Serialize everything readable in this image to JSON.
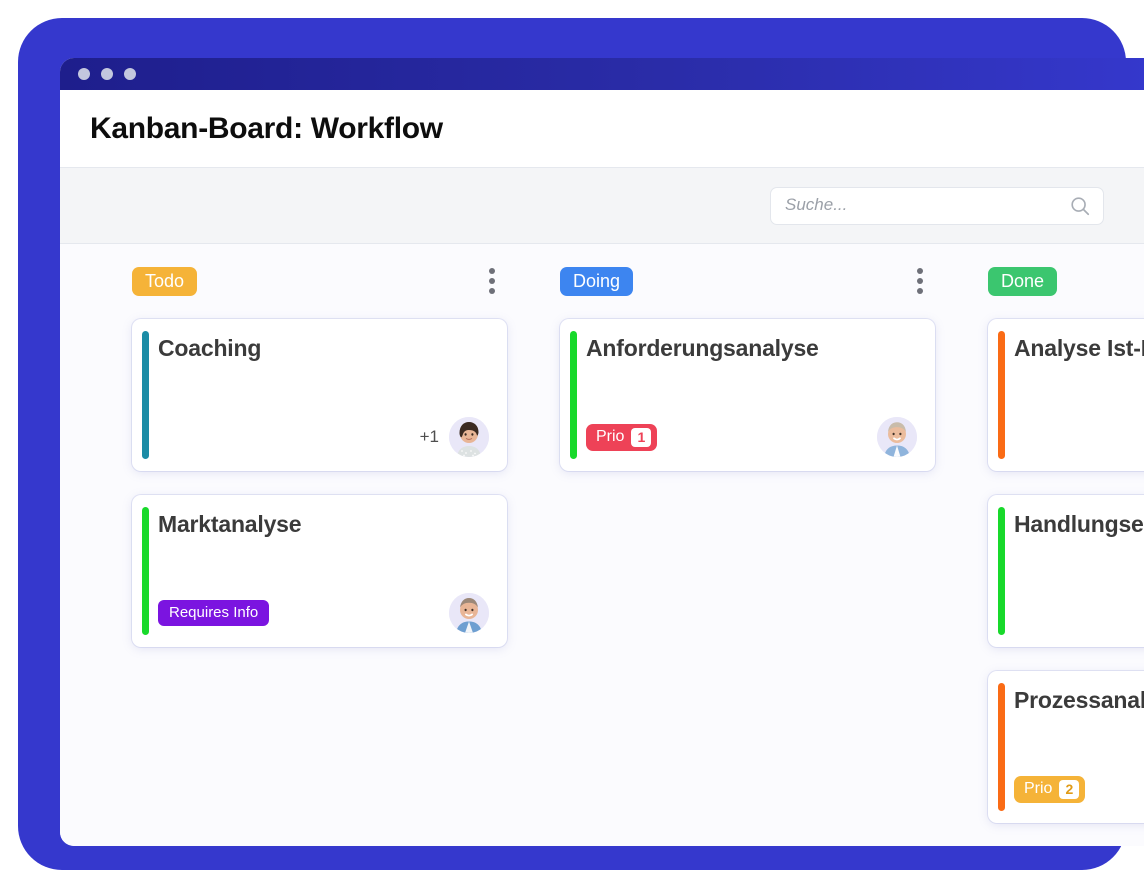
{
  "window": {
    "traffic_lights": [
      "close-dot",
      "minimize-dot",
      "maximize-dot"
    ]
  },
  "header": {
    "title": "Kanban-Board: Workflow"
  },
  "toolbar": {
    "search": {
      "placeholder": "Suche...",
      "value": "",
      "icon": "search-icon"
    }
  },
  "board": {
    "columns": [
      {
        "id": "todo",
        "label": "Todo",
        "badge_color": "#F5B338",
        "menu_icon": "more-vertical-icon",
        "cards": [
          {
            "title": "Coaching",
            "accent_color": "#1B8CA6",
            "tags": [],
            "overflow_count": "+1",
            "avatar": "avatar-female-dark-hair"
          },
          {
            "title": "Marktanalyse",
            "accent_color": "#18D92B",
            "tags": [
              {
                "type": "plain",
                "label": "Requires Info",
                "color": "#7B14E0"
              }
            ],
            "overflow_count": "",
            "avatar": "avatar-male-blue-shirt"
          }
        ]
      },
      {
        "id": "doing",
        "label": "Doing",
        "badge_color": "#3D85F0",
        "menu_icon": "more-vertical-icon",
        "cards": [
          {
            "title": "Anforderungsanalyse",
            "accent_color": "#18D92B",
            "tags": [
              {
                "type": "count",
                "label": "Prio",
                "count": "1",
                "color": "#EE4257",
                "count_color": "#EE4257"
              }
            ],
            "overflow_count": "",
            "avatar": "avatar-male-light-hair"
          }
        ]
      },
      {
        "id": "done",
        "label": "Done",
        "badge_color": "#3BC66F",
        "menu_icon": "more-vertical-icon",
        "cards": [
          {
            "title": "Analyse Ist-Prozesse",
            "accent_color": "#FA6B15",
            "tags": [],
            "overflow_count": "",
            "avatar": ""
          },
          {
            "title": "Handlungsempfehlungen",
            "accent_color": "#18D92B",
            "tags": [],
            "overflow_count": "",
            "avatar": ""
          },
          {
            "title": "Prozessanalyse",
            "accent_color": "#FA6B15",
            "tags": [
              {
                "type": "count",
                "label": "Prio",
                "count": "2",
                "color": "#F5B338",
                "count_color": "#E09B17"
              }
            ],
            "overflow_count": "",
            "avatar": ""
          }
        ]
      }
    ]
  },
  "colors": {
    "frame": "#3538CD",
    "titlebar": "#2A2CA8",
    "board_bg": "#FBFBFE",
    "toolbar_bg": "#F4F5F7"
  }
}
